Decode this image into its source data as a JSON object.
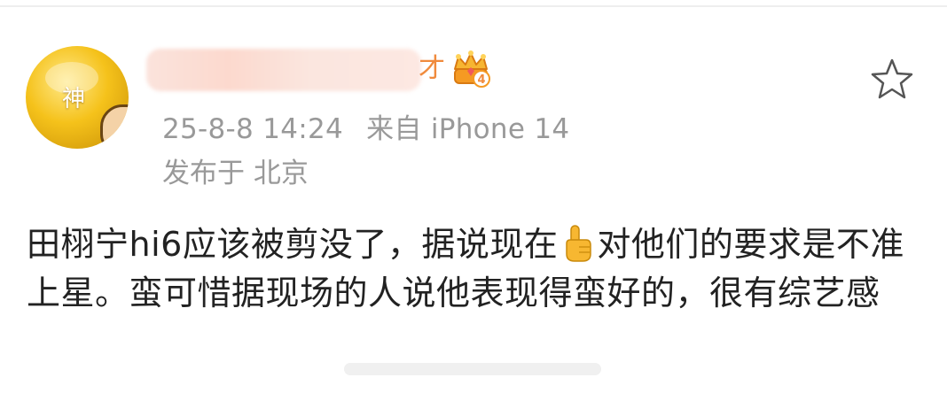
{
  "post": {
    "author": {
      "avatar_char": "神",
      "name_suffix": "才",
      "badge": "4",
      "badge_icon": "crown-badge-icon"
    },
    "timestamp": "25-8-8 14:24",
    "source": "来自 iPhone 14",
    "location": "发布于 北京",
    "content": {
      "part1": "田栩宁hi6应该被剪没了，据说现在",
      "emoji": "pointing-up-hand-icon",
      "part2": "对他们的要求是不准上星。蛮可惜据现场的人说他表现得蛮好的，很有综艺感"
    }
  },
  "actions": {
    "favorite_icon": "star-outline-icon"
  },
  "colors": {
    "meta_text": "#999999",
    "content_text": "#222222",
    "name_accent": "#f08a3c",
    "star_stroke": "#555555"
  }
}
